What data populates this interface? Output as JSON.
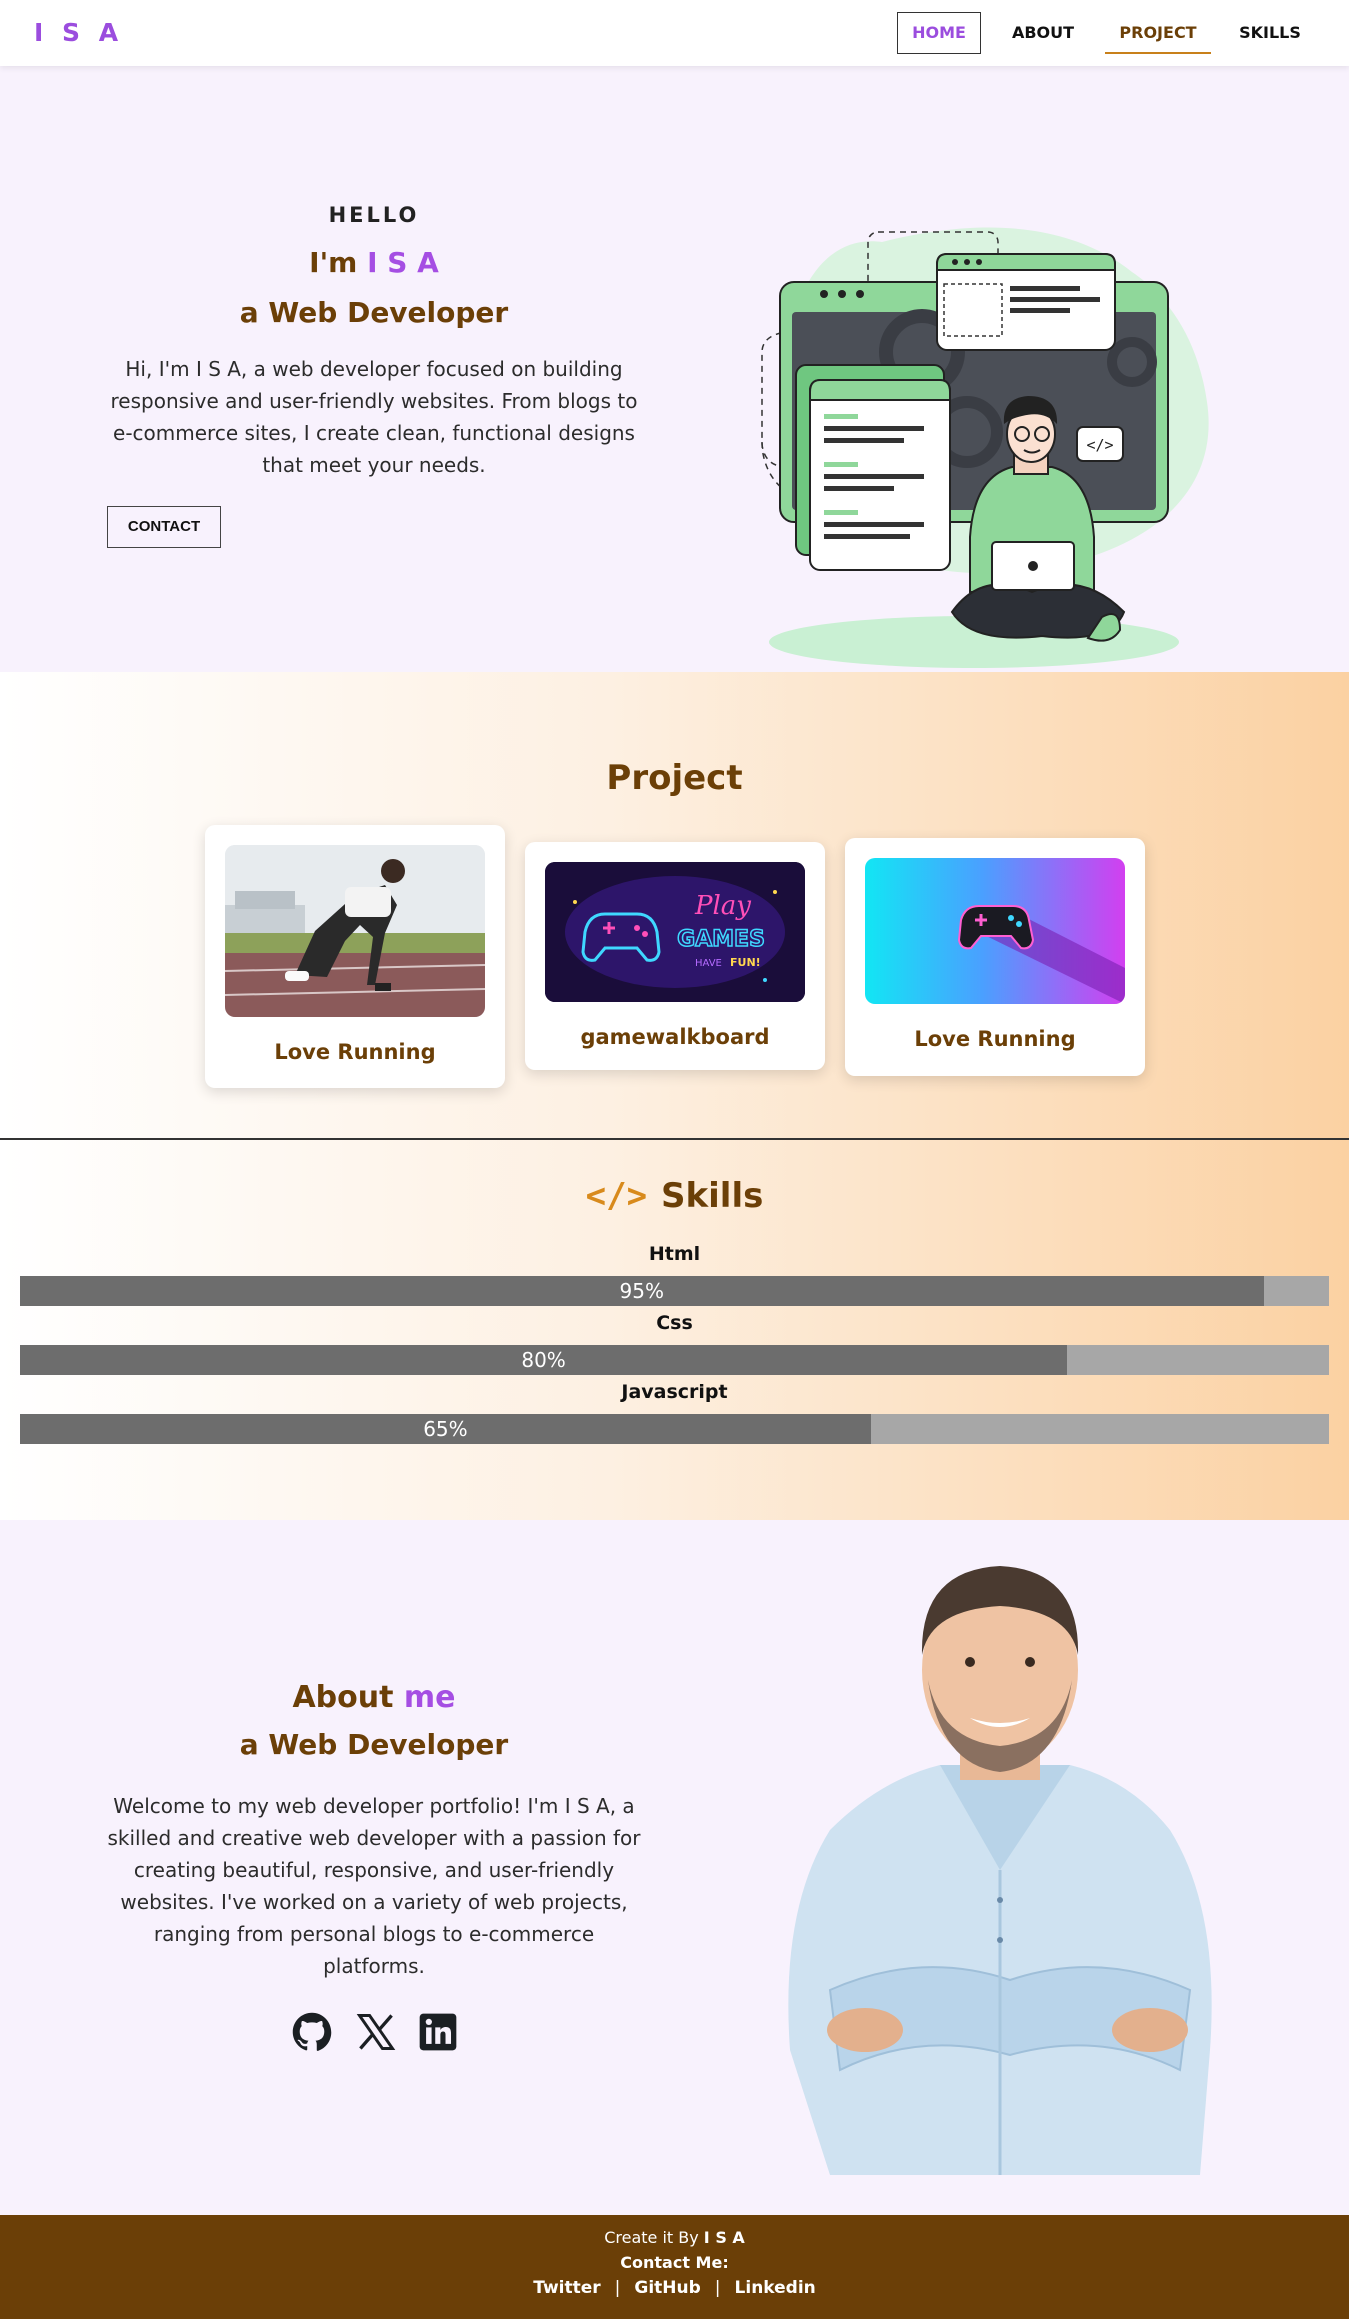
{
  "nav": {
    "logo": "I S A",
    "items": [
      {
        "label": "HOME",
        "active": true
      },
      {
        "label": "ABOUT"
      },
      {
        "label": "PROJECT"
      },
      {
        "label": "SKILLS"
      }
    ]
  },
  "hero": {
    "hello": "HELLO",
    "im_prefix": "I'm",
    "name": "I S A",
    "role": "a Web Developer",
    "text": "Hi, I'm I S A, a web developer focused on building responsive and user-friendly websites. From blogs to e-commerce sites, I create clean, functional designs that meet your needs.",
    "contact_label": "CONTACT"
  },
  "projects": {
    "title": "Project",
    "items": [
      {
        "label": "Love Running",
        "image": "runner-photo"
      },
      {
        "label": "gamewalkboard",
        "image": "neon-play-games-sign"
      },
      {
        "label": "Love Running",
        "image": "gamepad-gradient"
      }
    ]
  },
  "skills": {
    "icon": "</>",
    "title": "Skills",
    "items": [
      {
        "name": "Html",
        "percent_label": "95%",
        "value": 95
      },
      {
        "name": "Css",
        "percent_label": "80%",
        "value": 80
      },
      {
        "name": "Javascript",
        "percent_label": "65%",
        "value": 65
      }
    ]
  },
  "about": {
    "title_prefix": "About",
    "title_accent": "me",
    "role": "a Web Developer",
    "text": "Welcome to my web developer portfolio! I'm I S A, a skilled and creative web developer with a passion for creating beautiful, responsive, and user-friendly websites. I've worked on a variety of web projects, ranging from personal blogs to e-commerce platforms.",
    "social": [
      "github-icon",
      "x-icon",
      "linkedin-icon"
    ]
  },
  "footer": {
    "created_prefix": "Create it By",
    "created_name": "I S A",
    "contact_label": "Contact Me:",
    "links": [
      "Twitter",
      "GitHub",
      "Linkedin"
    ],
    "separator": "|"
  },
  "colors": {
    "accent_purple": "#a54ee3",
    "brand_brown": "#6b3f07",
    "orange": "#d88a1c",
    "green": "#8fd79a"
  }
}
